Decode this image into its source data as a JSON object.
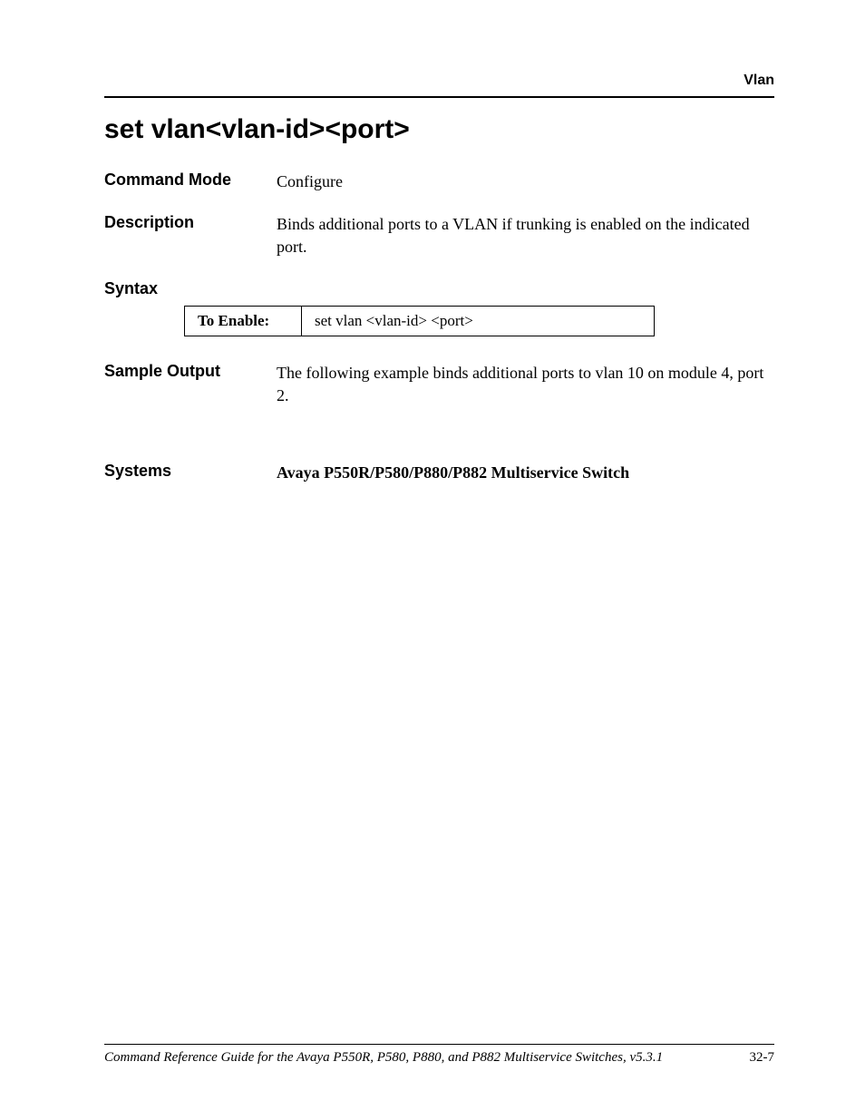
{
  "header": {
    "running_head": "Vlan"
  },
  "title": "set vlan<vlan-id><port>",
  "sections": {
    "command_mode": {
      "label": "Command Mode",
      "value": "Configure"
    },
    "description": {
      "label": "Description",
      "value": "Binds additional ports to a VLAN if trunking is enabled on the indicated port."
    },
    "syntax": {
      "label": "Syntax",
      "table": {
        "row_label": "To Enable:",
        "row_value": "set vlan <vlan-id> <port>"
      }
    },
    "sample_output": {
      "label": "Sample Output",
      "value": "The following example binds additional ports to vlan 10 on module 4, port 2."
    },
    "systems": {
      "label": "Systems",
      "value": "Avaya P550R/P580/P880/P882 Multiservice Switch"
    }
  },
  "footer": {
    "text": "Command Reference Guide for the Avaya P550R, P580, P880, and P882 Multiservice Switches, v5.3.1",
    "page": "32-7"
  }
}
